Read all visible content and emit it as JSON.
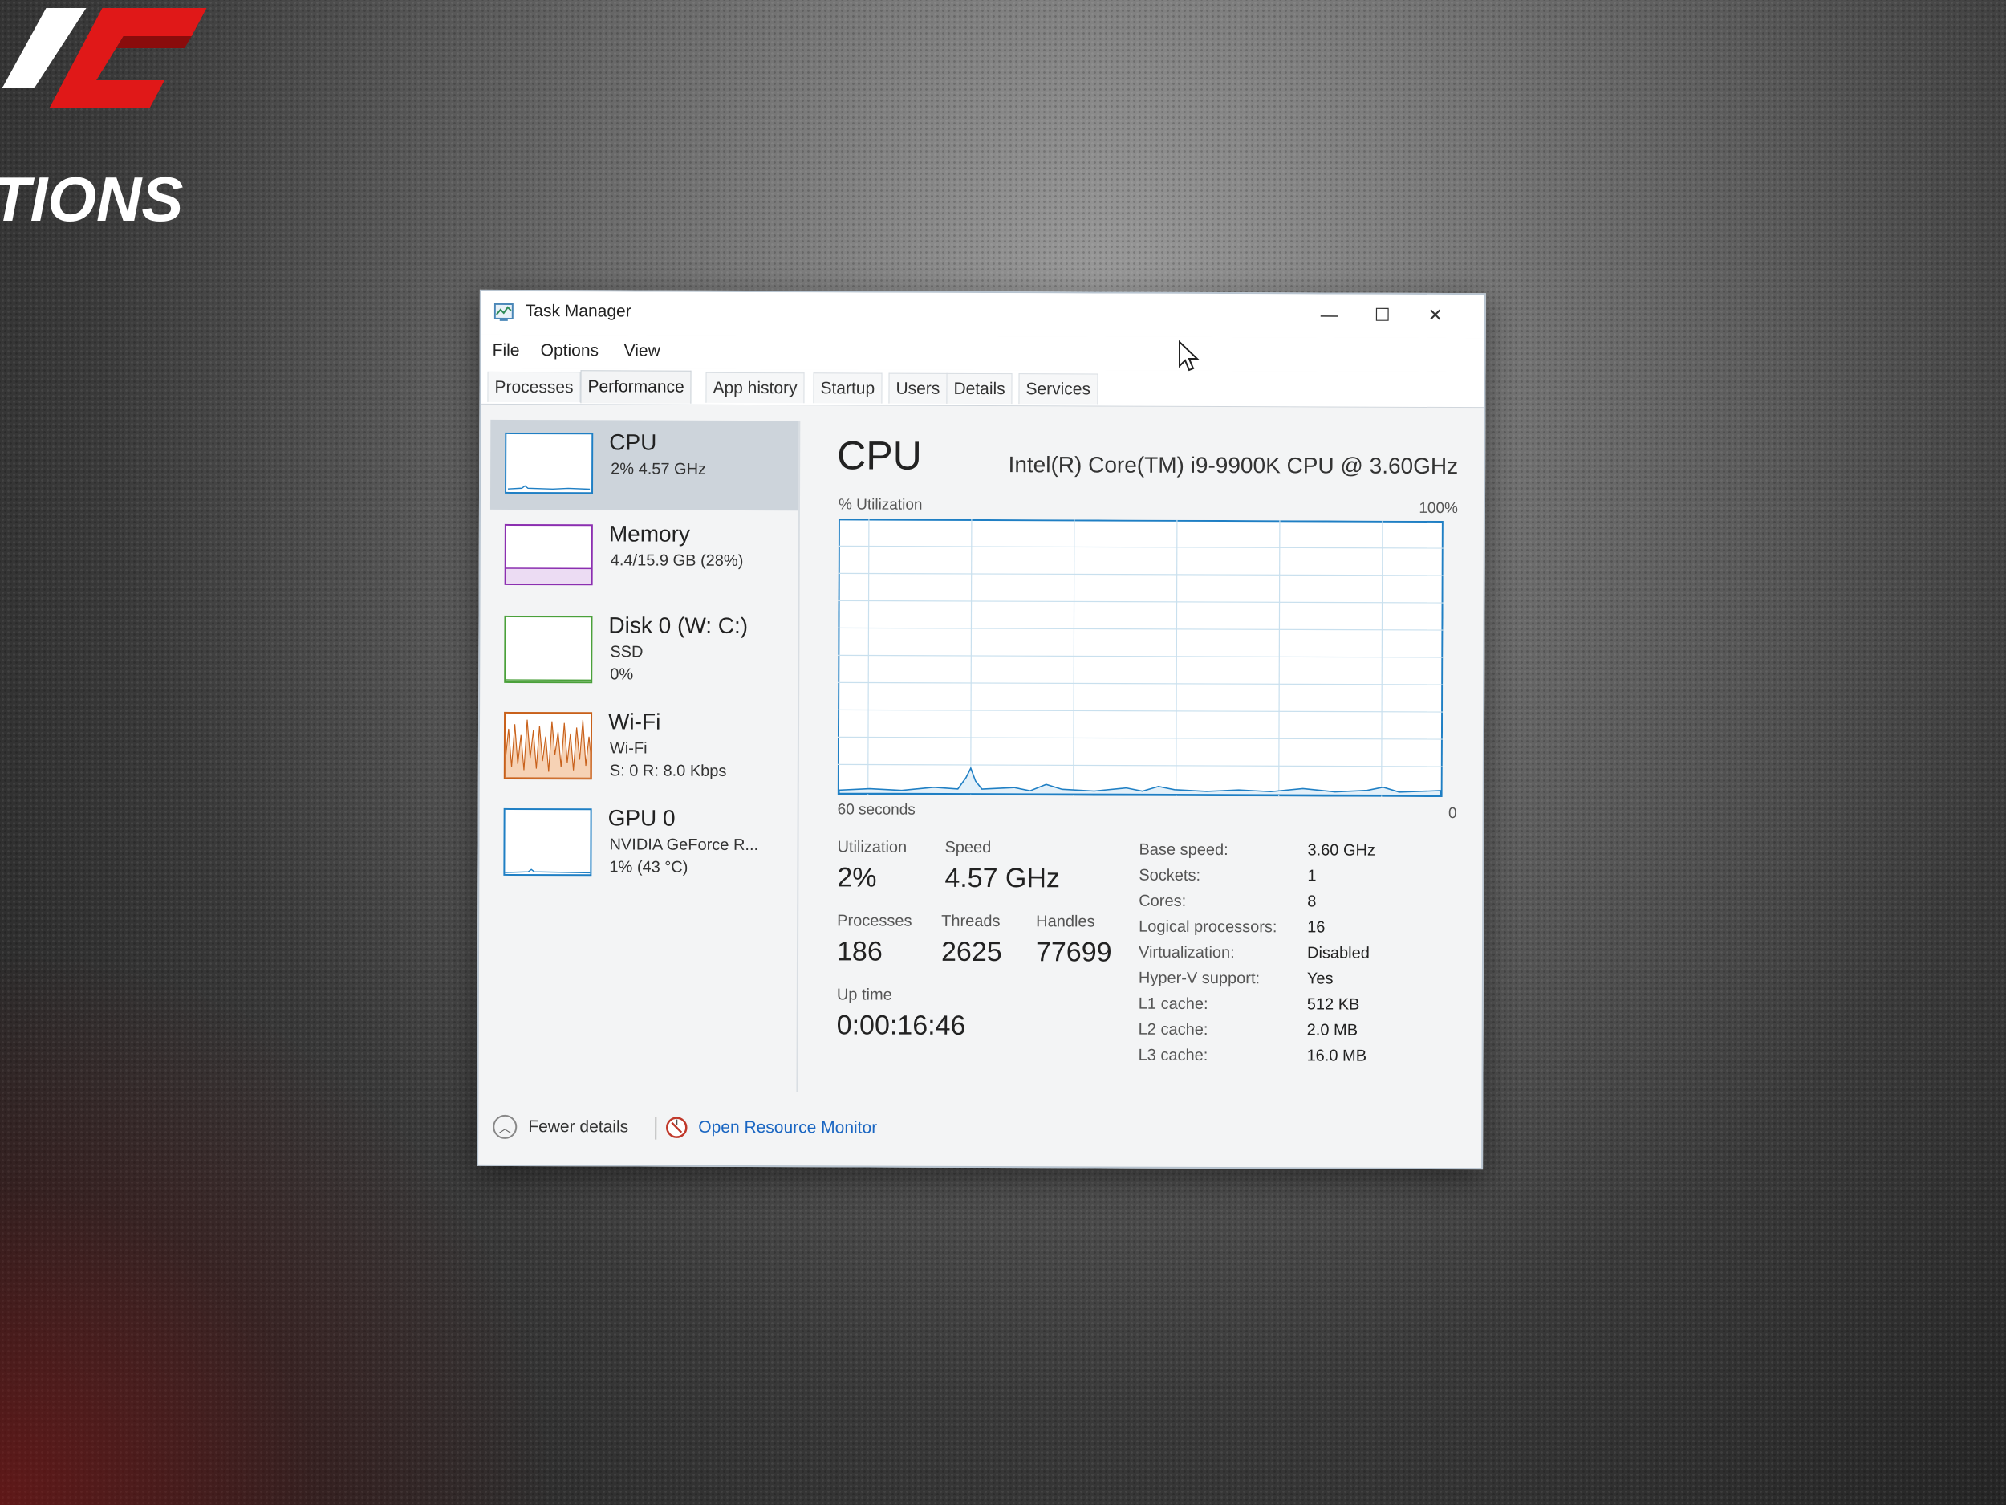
{
  "window": {
    "title": "Task Manager",
    "controls": {
      "minimize": "—",
      "maximize": "☐",
      "close": "✕"
    }
  },
  "menu": [
    "File",
    "Options",
    "View"
  ],
  "tabs": [
    "Processes",
    "Performance",
    "App history",
    "Startup",
    "Users",
    "Details",
    "Services"
  ],
  "active_tab": "Performance",
  "sidebar": {
    "items": [
      {
        "title": "CPU",
        "lines": [
          "2% 4.57 GHz"
        ],
        "color": "#1f7fc4",
        "selected": true
      },
      {
        "title": "Memory",
        "lines": [
          "4.4/15.9 GB (28%)"
        ],
        "color": "#8b2fb0",
        "selected": false
      },
      {
        "title": "Disk 0 (W: C:)",
        "lines": [
          "SSD",
          "0%"
        ],
        "color": "#4aa03a",
        "selected": false
      },
      {
        "title": "Wi-Fi",
        "lines": [
          "Wi-Fi",
          "S: 0 R: 8.0 Kbps"
        ],
        "color": "#c8601a",
        "selected": false
      },
      {
        "title": "GPU 0",
        "lines": [
          "NVIDIA GeForce R...",
          "1% (43 °C)"
        ],
        "color": "#1f7fc4",
        "selected": false
      }
    ]
  },
  "main": {
    "title": "CPU",
    "model": "Intel(R) Core(TM) i9-9900K CPU @ 3.60GHz",
    "graph": {
      "top_left": "% Utilization",
      "top_right": "100%",
      "bottom_left": "60 seconds",
      "bottom_right": "0",
      "line_color": "#1f7fc4",
      "grid_color": "#c9e0ee"
    },
    "stats": {
      "utilization_label": "Utilization",
      "utilization_value": "2%",
      "speed_label": "Speed",
      "speed_value": "4.57 GHz",
      "processes_label": "Processes",
      "processes_value": "186",
      "threads_label": "Threads",
      "threads_value": "2625",
      "handles_label": "Handles",
      "handles_value": "77699",
      "uptime_label": "Up time",
      "uptime_value": "0:00:16:46"
    },
    "details": [
      {
        "label": "Base speed:",
        "value": "3.60 GHz"
      },
      {
        "label": "Sockets:",
        "value": "1"
      },
      {
        "label": "Cores:",
        "value": "8"
      },
      {
        "label": "Logical processors:",
        "value": "16"
      },
      {
        "label": "Virtualization:",
        "value": "Disabled"
      },
      {
        "label": "Hyper-V support:",
        "value": "Yes"
      },
      {
        "label": "L1 cache:",
        "value": "512 KB"
      },
      {
        "label": "L2 cache:",
        "value": "2.0 MB"
      },
      {
        "label": "L3 cache:",
        "value": "16.0 MB"
      }
    ]
  },
  "footer": {
    "fewer_details": "Fewer details",
    "open_resource_monitor": "Open Resource Monitor"
  },
  "background": {
    "logo_lines": [
      "KC",
      "TIONS"
    ],
    "logo_colors": {
      "red": "#e01818",
      "white": "#ffffff"
    }
  }
}
